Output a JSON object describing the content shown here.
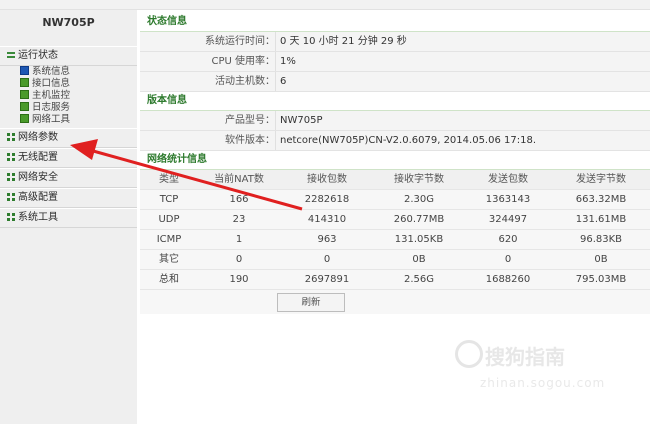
{
  "device_name": "NW705P",
  "sidebar": {
    "groups": [
      {
        "label": "运行状态",
        "items": [
          "系统信息",
          "接口信息",
          "主机监控",
          "日志服务",
          "网络工具"
        ]
      },
      {
        "label": "网络参数"
      },
      {
        "label": "无线配置"
      },
      {
        "label": "网络安全"
      },
      {
        "label": "高级配置"
      },
      {
        "label": "系统工具"
      }
    ]
  },
  "status": {
    "title": "状态信息",
    "rows": [
      {
        "label": "系统运行时间：",
        "value": "0 天 10 小时 21 分钟 29 秒"
      },
      {
        "label": "CPU 使用率：",
        "value": "1%"
      },
      {
        "label": "活动主机数：",
        "value": "6"
      }
    ]
  },
  "version": {
    "title": "版本信息",
    "rows": [
      {
        "label": "产品型号：",
        "value": "NW705P"
      },
      {
        "label": "软件版本：",
        "value": "netcore(NW705P)CN-V2.0.6079, 2014.05.06 17:18."
      }
    ]
  },
  "stats": {
    "title": "网络统计信息",
    "headers": [
      "类型",
      "当前NAT数",
      "接收包数",
      "接收字节数",
      "发送包数",
      "发送字节数"
    ],
    "rows": [
      [
        "TCP",
        "166",
        "2282618",
        "2.30G",
        "1363143",
        "663.32MB"
      ],
      [
        "UDP",
        "23",
        "414310",
        "260.77MB",
        "324497",
        "131.61MB"
      ],
      [
        "ICMP",
        "1",
        "963",
        "131.05KB",
        "620",
        "96.83KB"
      ],
      [
        "其它",
        "0",
        "0",
        "0B",
        "0",
        "0B"
      ],
      [
        "总和",
        "190",
        "2697891",
        "2.56G",
        "1688260",
        "795.03MB"
      ]
    ],
    "refresh_label": "刷新"
  },
  "watermark": {
    "text": "搜狗指南",
    "url": "zhinan.sogou.com"
  },
  "colors": {
    "accent_green": "#2d7a2d",
    "arrow_red": "#e02020"
  }
}
